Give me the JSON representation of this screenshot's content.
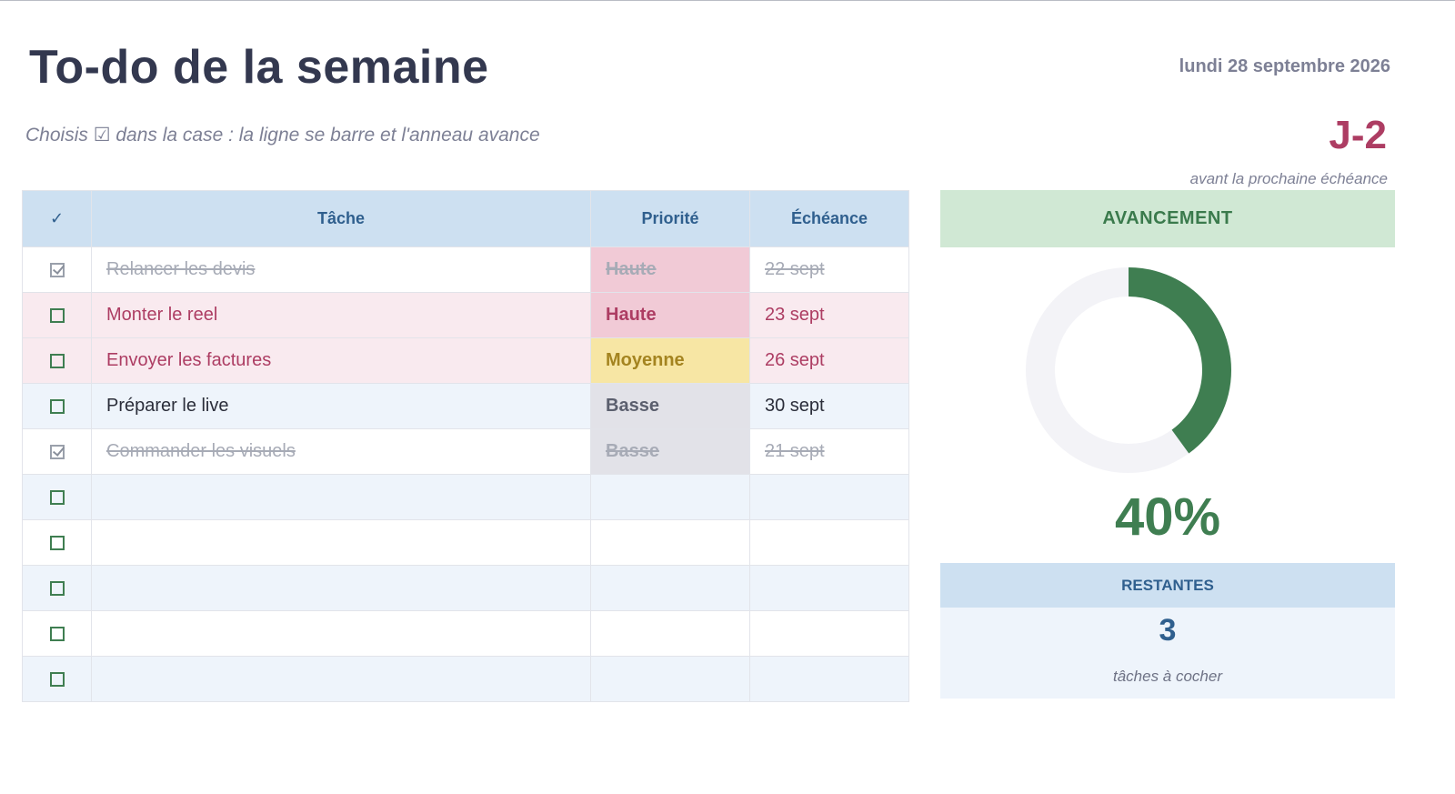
{
  "header": {
    "title": "To-do de la semaine",
    "subtitle": "Choisis ☑ dans la case : la ligne se barre et l'anneau avance",
    "date": "lundi 28 septembre 2026",
    "countdown": "J-2",
    "countdown_caption": "avant la prochaine échéance"
  },
  "table": {
    "columns": {
      "check": "✓",
      "task": "Tâche",
      "priority": "Priorité",
      "due": "Échéance"
    },
    "rows": [
      {
        "checked": true,
        "task": "Relancer les devis",
        "priority": "Haute",
        "due": "22 sept"
      },
      {
        "checked": false,
        "task": "Monter le reel",
        "priority": "Haute",
        "due": "23 sept"
      },
      {
        "checked": false,
        "task": "Envoyer les factures",
        "priority": "Moyenne",
        "due": "26 sept"
      },
      {
        "checked": false,
        "task": "Préparer le live",
        "priority": "Basse",
        "due": "30 sept"
      },
      {
        "checked": true,
        "task": "Commander les visuels",
        "priority": "Basse",
        "due": "21 sept"
      },
      {
        "checked": false,
        "task": "",
        "priority": "",
        "due": ""
      },
      {
        "checked": false,
        "task": "",
        "priority": "",
        "due": ""
      },
      {
        "checked": false,
        "task": "",
        "priority": "",
        "due": ""
      },
      {
        "checked": false,
        "task": "",
        "priority": "",
        "due": ""
      },
      {
        "checked": false,
        "task": "",
        "priority": "",
        "due": ""
      }
    ]
  },
  "progress": {
    "heading": "AVANCEMENT",
    "percent_label": "40%",
    "fraction": 0.4,
    "colors": {
      "fill": "#3f7e51",
      "track": "#f3f3f7"
    }
  },
  "remaining": {
    "heading": "RESTANTES",
    "count": "3",
    "caption": "tâches à cocher"
  }
}
